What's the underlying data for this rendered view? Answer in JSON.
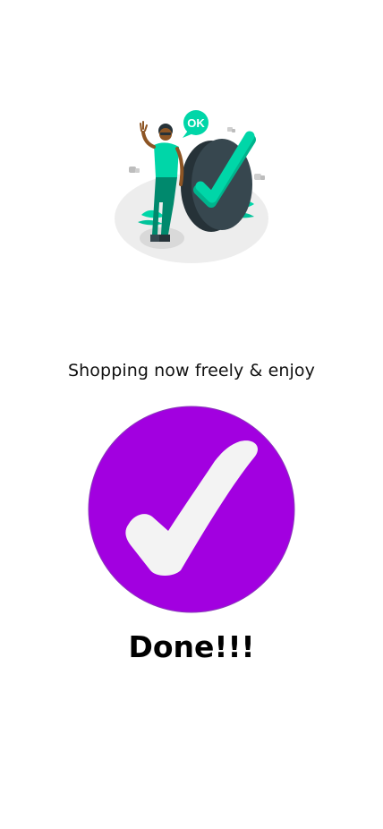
{
  "screen": {
    "subtitle": "Shopping now freely & enjoy",
    "title": "Done!!!"
  },
  "illustration": {
    "speech_bubble_text": "OK",
    "accent_color": "#00d6a8",
    "icon": "person-with-checkmark-illustration"
  },
  "check_badge": {
    "icon": "checkmark-icon",
    "background_color": "#a200e0",
    "check_color": "#f3f3f3"
  }
}
